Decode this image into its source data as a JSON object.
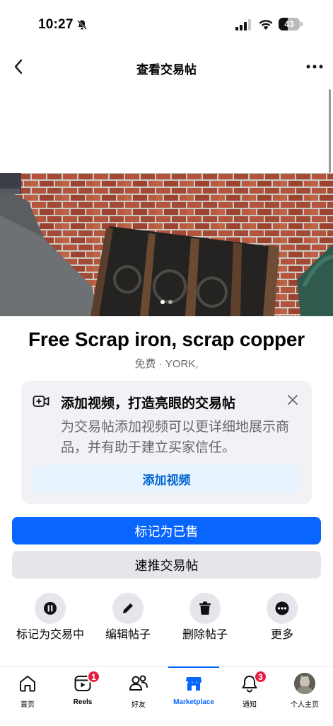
{
  "status_bar": {
    "time": "10:27",
    "battery": "43",
    "battery_level": 0.43
  },
  "nav": {
    "title": "查看交易帖"
  },
  "photo": {
    "page_count": 2,
    "current_page": 1
  },
  "listing": {
    "title": "Free Scrap iron, scrap copper",
    "meta": "免费 · YORK,"
  },
  "promo": {
    "title": "添加视频，打造亮眼的交易帖",
    "description": "为交易帖添加视频可以更详细地展示商品，并有助于建立买家信任。",
    "button": "添加视频"
  },
  "buttons": {
    "mark_sold": "标记为已售",
    "boost": "速推交易帖"
  },
  "actions": [
    {
      "label": "标记为交易中",
      "icon": "pause-icon"
    },
    {
      "label": "编辑帖子",
      "icon": "pencil-icon"
    },
    {
      "label": "删除帖子",
      "icon": "trash-icon"
    },
    {
      "label": "更多",
      "icon": "more-dots-icon"
    }
  ],
  "tabs": [
    {
      "label": "首页",
      "icon": "home-icon"
    },
    {
      "label": "Reels",
      "icon": "reels-icon",
      "badge": "1"
    },
    {
      "label": "好友",
      "icon": "friends-icon"
    },
    {
      "label": "Marketplace",
      "icon": "marketplace-icon",
      "active": true
    },
    {
      "label": "通知",
      "icon": "bell-icon",
      "badge": "3"
    },
    {
      "label": "个人主页",
      "icon": "avatar"
    }
  ],
  "colors": {
    "accent": "#0866ff",
    "badge": "#e41e3f",
    "secondary_bg": "#e4e6eb",
    "promo_bg": "#f0f2f5"
  }
}
